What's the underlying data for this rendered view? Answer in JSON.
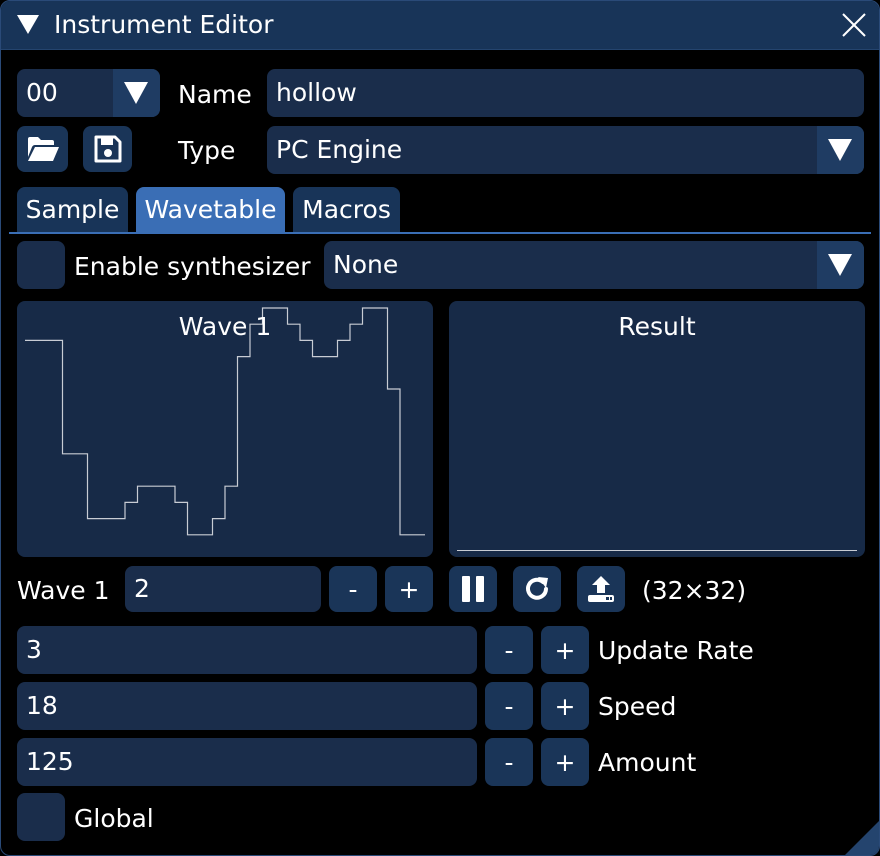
{
  "window": {
    "title": "Instrument Editor"
  },
  "instrument": {
    "index": "00",
    "name_label": "Name",
    "name_value": "hollow",
    "type_label": "Type",
    "type_value": "PC Engine"
  },
  "tabs": [
    {
      "label": "Sample",
      "active": false
    },
    {
      "label": "Wavetable",
      "active": true
    },
    {
      "label": "Macros",
      "active": false
    }
  ],
  "synth": {
    "enable_label": "Enable synthesizer",
    "enabled": false,
    "mode": "None"
  },
  "panels": {
    "wave_title": "Wave 1",
    "result_title": "Result"
  },
  "wave_data": [
    13,
    13,
    13,
    6,
    6,
    2,
    2,
    2,
    3,
    4,
    4,
    4,
    3,
    1,
    1,
    2,
    4,
    12,
    14,
    15,
    15,
    14,
    13,
    12,
    12,
    13,
    14,
    15,
    15,
    10,
    1,
    1
  ],
  "wave_ctrl": {
    "label": "Wave 1",
    "value": "2",
    "minus": "-",
    "plus": "+",
    "size": "(32×32)"
  },
  "params": [
    {
      "value": "3",
      "label": "Update Rate"
    },
    {
      "value": "18",
      "label": "Speed"
    },
    {
      "value": "125",
      "label": "Amount"
    }
  ],
  "step": {
    "minus": "-",
    "plus": "+"
  },
  "global": {
    "label": "Global",
    "checked": false
  },
  "colors": {
    "window_bg": "#000000",
    "titlebar": "#183458",
    "control": "#1a2d4b",
    "button": "#1a3558",
    "tab_active": "#3a6eb5",
    "wave_line": "#c8ccd4"
  },
  "icons": {
    "title": "collapse-triangle-icon",
    "close": "close-x-icon",
    "open": "folder-open-icon",
    "save": "floppy-disk-icon",
    "pause": "pause-icon",
    "reset": "rotate-icon",
    "upload": "upload-tray-icon"
  }
}
